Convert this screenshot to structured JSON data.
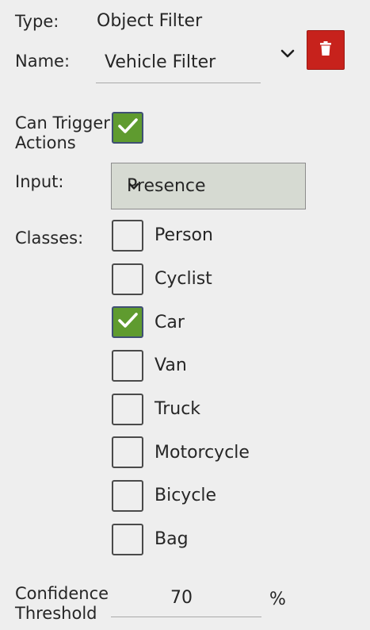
{
  "filter": {
    "type_label": "Type:",
    "type_value": "Object Filter",
    "name_label": "Name:",
    "name_value": "Vehicle Filter",
    "collapse_icon": "chevron-down-icon",
    "delete_icon": "trash-icon",
    "delete_color": "#c7221c"
  },
  "trigger": {
    "label_line1": "Can Trigger",
    "label_line2": "Actions",
    "checked": true
  },
  "input": {
    "label": "Input:",
    "selected": "Presence"
  },
  "classes": {
    "label": "Classes:",
    "items": [
      {
        "label": "Person",
        "checked": false
      },
      {
        "label": "Cyclist",
        "checked": false
      },
      {
        "label": "Car",
        "checked": true
      },
      {
        "label": "Van",
        "checked": false
      },
      {
        "label": "Truck",
        "checked": false
      },
      {
        "label": "Motorcycle",
        "checked": false
      },
      {
        "label": "Bicycle",
        "checked": false
      },
      {
        "label": "Bag",
        "checked": false
      }
    ]
  },
  "threshold": {
    "label_line1": "Confidence",
    "label_line2": "Threshold",
    "value": "70",
    "unit": "%"
  },
  "colors": {
    "checked_fill": "#5f9b2f",
    "select_bg": "#d6dad2",
    "page_bg": "#eeeeee"
  }
}
